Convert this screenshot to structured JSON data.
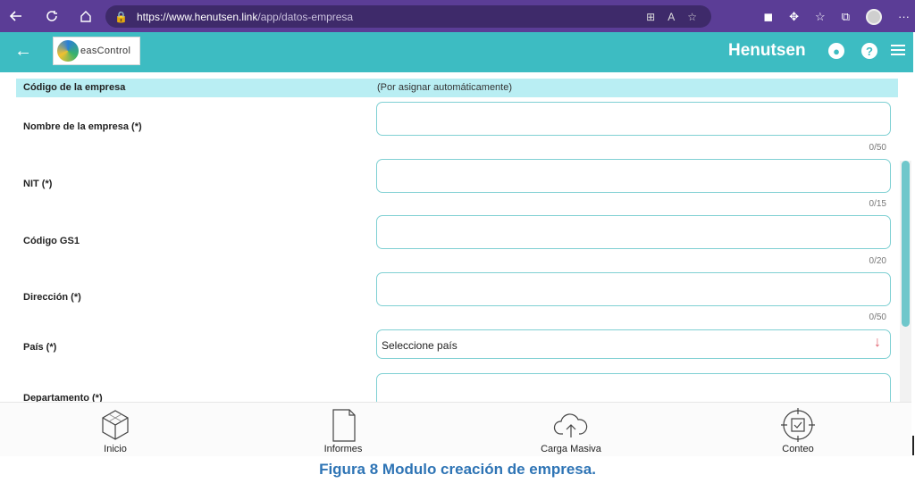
{
  "browser": {
    "url_host": "https://www.henutsen.link",
    "url_path": "/app/datos-empresa",
    "more_label": "···"
  },
  "header": {
    "logo_text": "easControl",
    "brand": "Henutsen"
  },
  "form": {
    "code": {
      "label": "Código de la empresa",
      "value": "(Por asignar automáticamente)"
    },
    "fields": [
      {
        "label": "Nombre de la empresa (*)",
        "counter": "0/50"
      },
      {
        "label": "NIT (*)",
        "counter": "0/15"
      },
      {
        "label": "Código GS1",
        "counter": "0/20"
      },
      {
        "label": "Dirección (*)",
        "counter": "0/50"
      },
      {
        "label": "País (*)",
        "select_value": "Seleccione país"
      },
      {
        "label": "Departamento (*)"
      }
    ]
  },
  "bottom_nav": [
    {
      "label": "Inicio",
      "icon": "cube-icon"
    },
    {
      "label": "Informes",
      "icon": "document-icon"
    },
    {
      "label": "Carga Masiva",
      "icon": "cloud-upload-icon"
    },
    {
      "label": "Conteo",
      "icon": "target-scan-icon"
    }
  ],
  "caption": "Figura 8 Modulo creación de empresa.",
  "colors": {
    "browser": "#5b3d96",
    "header": "#3dbcc2",
    "field_border": "#7fd0d3",
    "caption": "#2e74b5"
  }
}
